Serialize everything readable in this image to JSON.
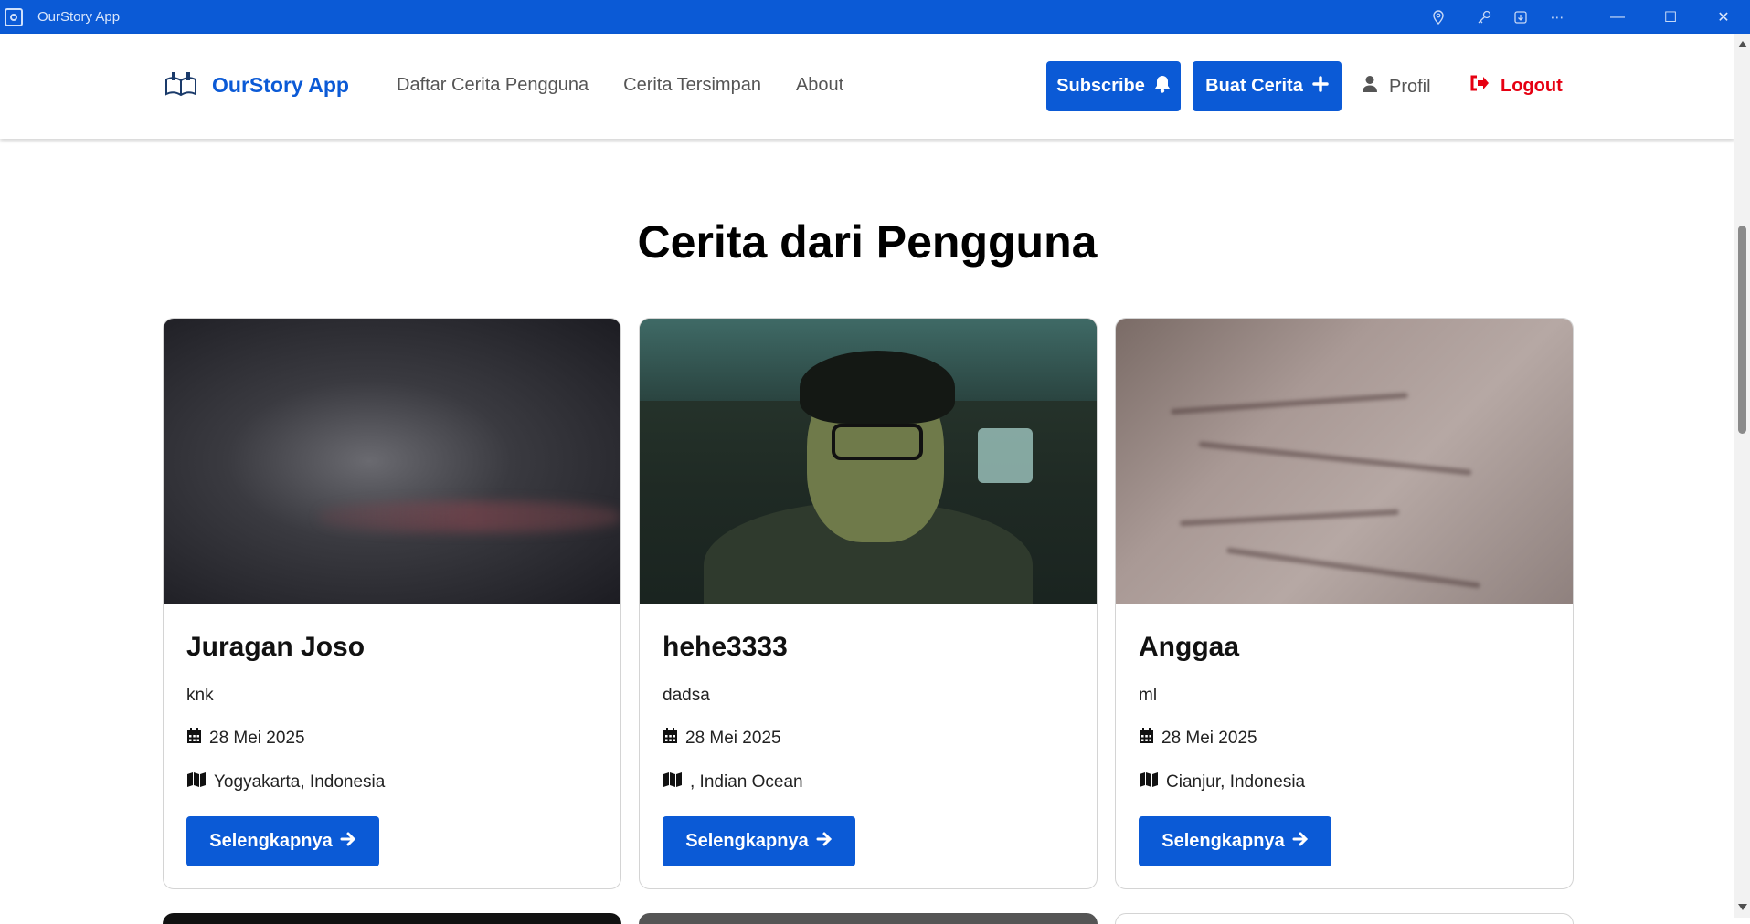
{
  "window": {
    "title": "OurStory App",
    "icons": [
      "location-icon",
      "key-icon",
      "install-app-icon",
      "more-icon"
    ],
    "controls": [
      "minimize-icon",
      "maximize-icon",
      "close-icon"
    ]
  },
  "navbar": {
    "brand": "OurStory App",
    "links": [
      "Daftar Cerita Pengguna",
      "Cerita Tersimpan",
      "About"
    ],
    "subscribe_label": "Subscribe",
    "buat_label": "Buat Cerita",
    "profil_label": "Profil",
    "logout_label": "Logout"
  },
  "page": {
    "title": "Cerita dari Pengguna"
  },
  "stories": [
    {
      "name": "Juragan Joso",
      "description": "knk",
      "date": "28 Mei 2025",
      "location": "Yogyakarta, Indonesia",
      "button": "Selengkapnya"
    },
    {
      "name": "hehe3333",
      "description": "dadsa",
      "date": "28 Mei 2025",
      "location": ", Indian Ocean",
      "button": "Selengkapnya"
    },
    {
      "name": "Anggaa",
      "description": "ml",
      "date": "28 Mei 2025",
      "location": "Cianjur, Indonesia",
      "button": "Selengkapnya"
    }
  ],
  "colors": {
    "primary": "#0b5ad6",
    "logout": "#e60012",
    "titlebar": "#0b5ad6"
  }
}
